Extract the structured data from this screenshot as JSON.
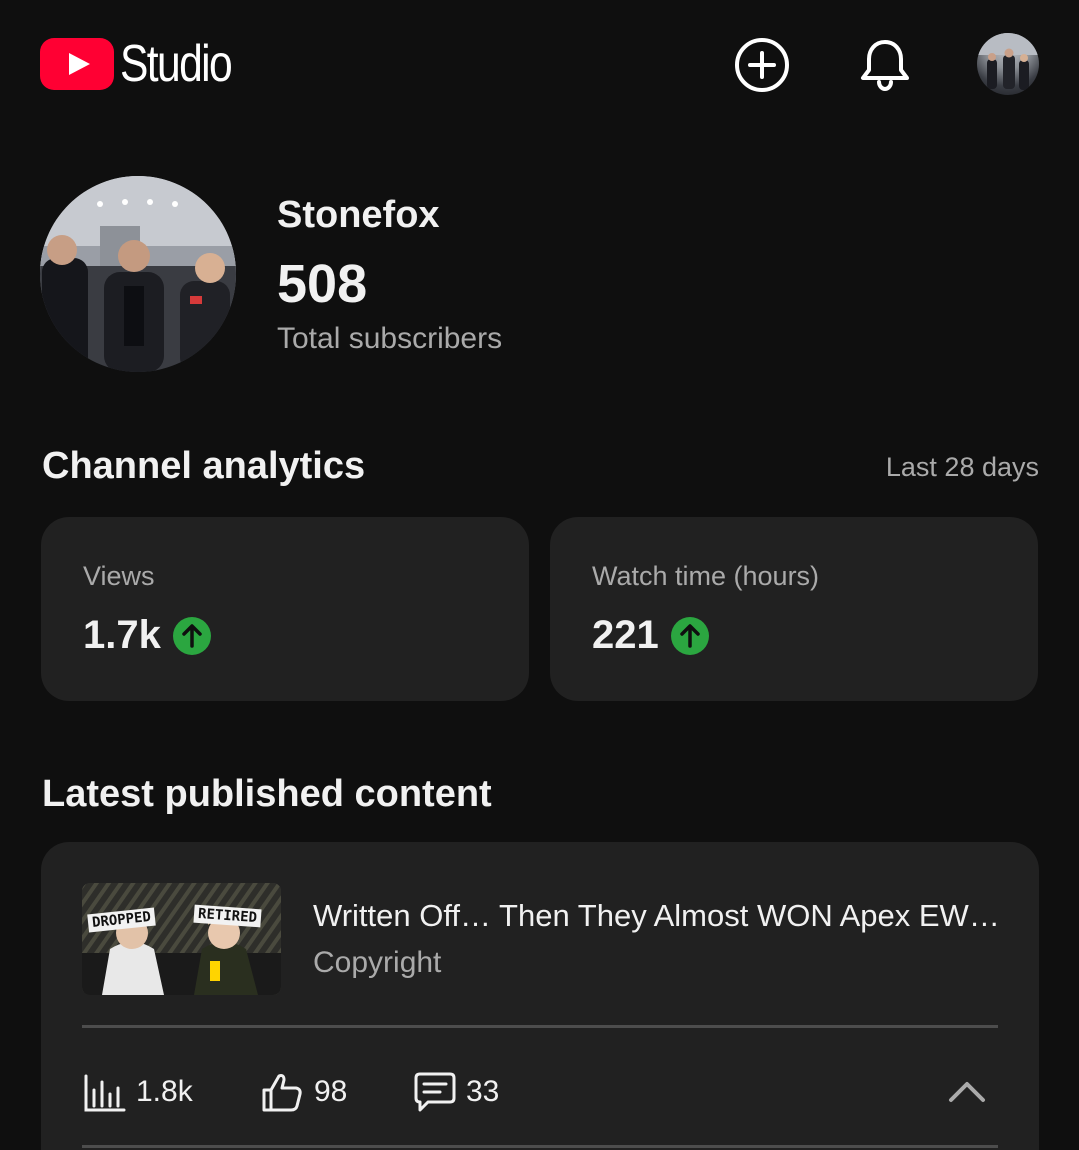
{
  "app": {
    "logo_text": "Studio",
    "colors": {
      "brand": "#ff0033",
      "background": "#0f0f0f",
      "card": "#212121",
      "up_trend": "#2ba640"
    }
  },
  "header": {
    "icons": [
      "create-icon",
      "bell-icon",
      "account-avatar"
    ]
  },
  "channel": {
    "name": "Stonefox",
    "subscribers": "508",
    "subscribers_label": "Total subscribers"
  },
  "analytics": {
    "title": "Channel analytics",
    "period": "Last 28 days",
    "cards": [
      {
        "label": "Views",
        "value": "1.7k",
        "trend": "up"
      },
      {
        "label": "Watch time (hours)",
        "value": "221",
        "trend": "up"
      }
    ]
  },
  "latest": {
    "title": "Latest published content",
    "video": {
      "title": "Written Off… Then They Almost WON Apex EW…",
      "status": "Copyright",
      "thumbnail_left_label": "DROPPED",
      "thumbnail_right_label": "RETIRED",
      "views": "1.8k",
      "likes": "98",
      "comments": "33"
    }
  }
}
